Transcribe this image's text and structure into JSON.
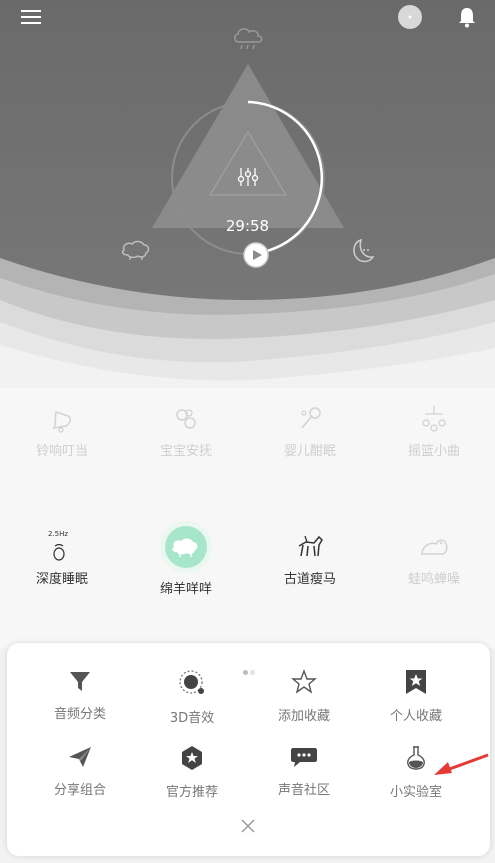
{
  "header": {
    "menu_icon": "hamburger-icon",
    "avatar_icon": "avatar",
    "bell_icon": "bell-icon"
  },
  "player": {
    "timer": "29:58",
    "weather_icon": "rain-cloud-icon",
    "mixer_icon": "sliders-icon",
    "sheep_icon": "sheep-icon",
    "moon_icon": "moon-icon",
    "play_icon": "play-icon"
  },
  "sounds": {
    "row1": [
      {
        "label": "铃响叮当",
        "icon": "bell-icon"
      },
      {
        "label": "宝宝安抚",
        "icon": "pacifier-icon"
      },
      {
        "label": "婴儿酣眠",
        "icon": "rattle-icon"
      },
      {
        "label": "摇篮小曲",
        "icon": "mobile-icon"
      }
    ],
    "row2": [
      {
        "label": "深度睡眠",
        "icon": "brainwave-icon",
        "badge": "2.5Hz"
      },
      {
        "label": "绵羊咩咩",
        "icon": "sheep-icon"
      },
      {
        "label": "古道瘦马",
        "icon": "horse-icon"
      },
      {
        "label": "蛙鸣蝉噪",
        "icon": "frog-icon"
      }
    ]
  },
  "menu": {
    "items": [
      {
        "label": "音频分类",
        "icon": "filter-icon"
      },
      {
        "label": "3D音效",
        "icon": "3d-sound-icon"
      },
      {
        "label": "添加收藏",
        "icon": "star-icon"
      },
      {
        "label": "个人收藏",
        "icon": "bookmark-star-icon"
      },
      {
        "label": "分享组合",
        "icon": "paper-plane-icon"
      },
      {
        "label": "官方推荐",
        "icon": "badge-star-icon"
      },
      {
        "label": "声音社区",
        "icon": "chat-icon"
      },
      {
        "label": "小实验室",
        "icon": "flask-icon"
      }
    ],
    "close_icon": "close-icon",
    "page_dots": {
      "active": 1,
      "total": 2
    }
  },
  "colors": {
    "accent_green": "#a8e6cc",
    "arrow_red": "#e53935",
    "hero_bg": "#6e6e6e"
  }
}
